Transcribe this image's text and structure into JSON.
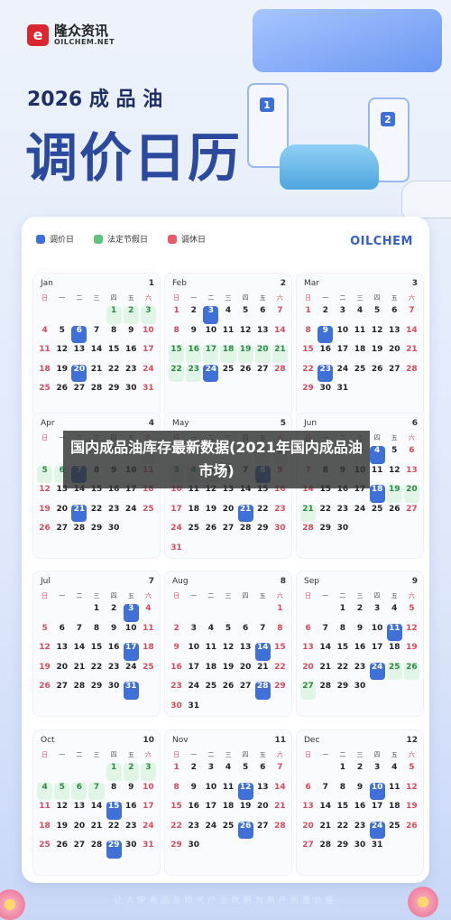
{
  "brand": {
    "logo_cn": "隆众资讯",
    "logo_en": "OILCHEM.NET",
    "logo_mark": "e"
  },
  "header": {
    "year_line": "2026 成 品 油",
    "title": "调价日历"
  },
  "illustration": {
    "pump_numbers": [
      "1",
      "2"
    ]
  },
  "legend": {
    "adjust": "调价日",
    "holiday": "法定节假日",
    "rest": "调休日",
    "brand": "OILCHEM"
  },
  "weekday_labels": [
    "日",
    "一",
    "二",
    "三",
    "四",
    "五",
    "六"
  ],
  "colors": {
    "adjust": "#3f70d8",
    "holiday": "#5ec27b",
    "rest": "#e65a6a",
    "title": "#2b4a9e"
  },
  "months": [
    {
      "name": "Jan",
      "num": "1",
      "start": 4,
      "days": 31,
      "adjust": [
        6,
        20
      ],
      "holiday": [
        1,
        2,
        3
      ],
      "rest": [
        4
      ]
    },
    {
      "name": "Feb",
      "num": "2",
      "start": 0,
      "days": 28,
      "adjust": [
        3,
        24
      ],
      "holiday": [
        15,
        16,
        17,
        18,
        19,
        20,
        21,
        22,
        23
      ],
      "rest": [
        14,
        28
      ]
    },
    {
      "name": "Mar",
      "num": "3",
      "start": 0,
      "days": 31,
      "adjust": [
        9,
        23
      ],
      "holiday": [],
      "rest": []
    },
    {
      "name": "Apr",
      "num": "4",
      "start": 3,
      "days": 30,
      "adjust": [
        7,
        21
      ],
      "holiday": [
        4,
        5,
        6
      ],
      "rest": []
    },
    {
      "name": "May",
      "num": "5",
      "start": 5,
      "days": 31,
      "adjust": [
        8,
        21
      ],
      "holiday": [
        1,
        2,
        3,
        4,
        5
      ],
      "rest": [
        9
      ]
    },
    {
      "name": "Jun",
      "num": "6",
      "start": 1,
      "days": 30,
      "adjust": [
        4,
        18
      ],
      "holiday": [
        19,
        20,
        21
      ],
      "rest": []
    },
    {
      "name": "Jul",
      "num": "7",
      "start": 3,
      "days": 31,
      "adjust": [
        3,
        17,
        31
      ],
      "holiday": [],
      "rest": []
    },
    {
      "name": "Aug",
      "num": "8",
      "start": 6,
      "days": 31,
      "adjust": [
        14,
        28
      ],
      "holiday": [],
      "rest": []
    },
    {
      "name": "Sep",
      "num": "9",
      "start": 2,
      "days": 30,
      "adjust": [
        11,
        24
      ],
      "holiday": [
        25,
        26,
        27
      ],
      "rest": []
    },
    {
      "name": "Oct",
      "num": "10",
      "start": 4,
      "days": 31,
      "adjust": [
        15,
        29
      ],
      "holiday": [
        1,
        2,
        3,
        4,
        5,
        6,
        7
      ],
      "rest": [
        10
      ]
    },
    {
      "name": "Nov",
      "num": "11",
      "start": 0,
      "days": 30,
      "adjust": [
        12,
        26
      ],
      "holiday": [],
      "rest": []
    },
    {
      "name": "Dec",
      "num": "12",
      "start": 2,
      "days": 31,
      "adjust": [
        10,
        24
      ],
      "holiday": [],
      "rest": []
    }
  ],
  "overlay_title": "国内成品油库存最新数据(2021年国内成品油市场)",
  "footer": "让大宗商品及相关产业数据为用户创造价值"
}
